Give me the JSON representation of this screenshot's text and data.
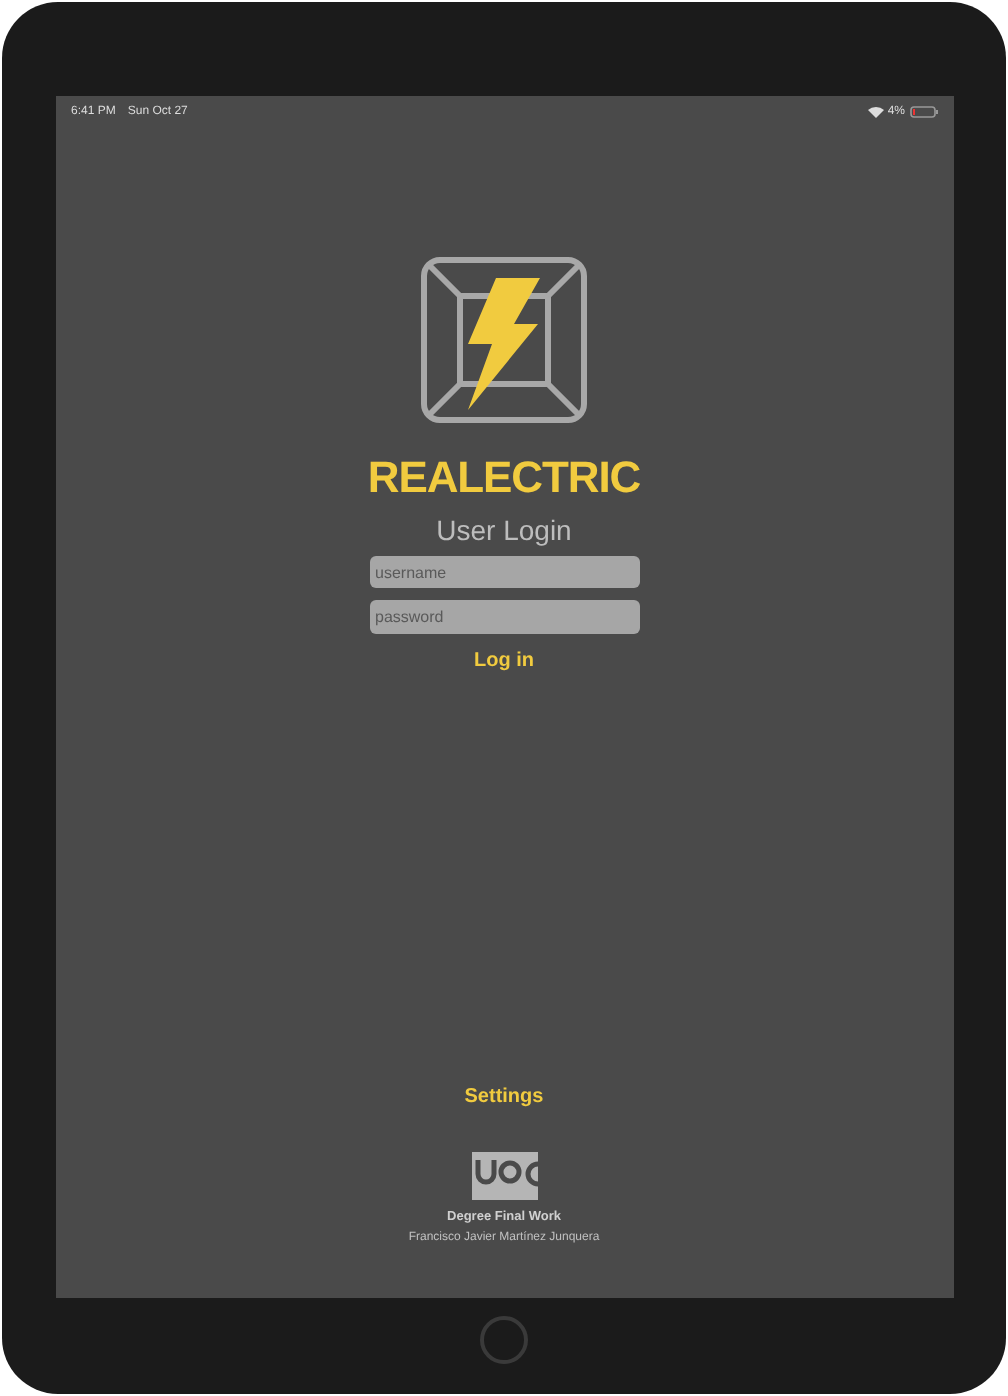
{
  "status_bar": {
    "time": "6:41 PM",
    "date": "Sun Oct 27",
    "battery": "4%"
  },
  "app": {
    "title": "REALECTRIC",
    "subtitle": "User Login"
  },
  "form": {
    "username": {
      "placeholder": "username"
    },
    "password": {
      "placeholder": "password"
    },
    "submit": "Log in"
  },
  "footer": {
    "settings": "Settings",
    "caption": "Degree Final Work",
    "author": "Francisco Javier Martínez Junquera"
  }
}
